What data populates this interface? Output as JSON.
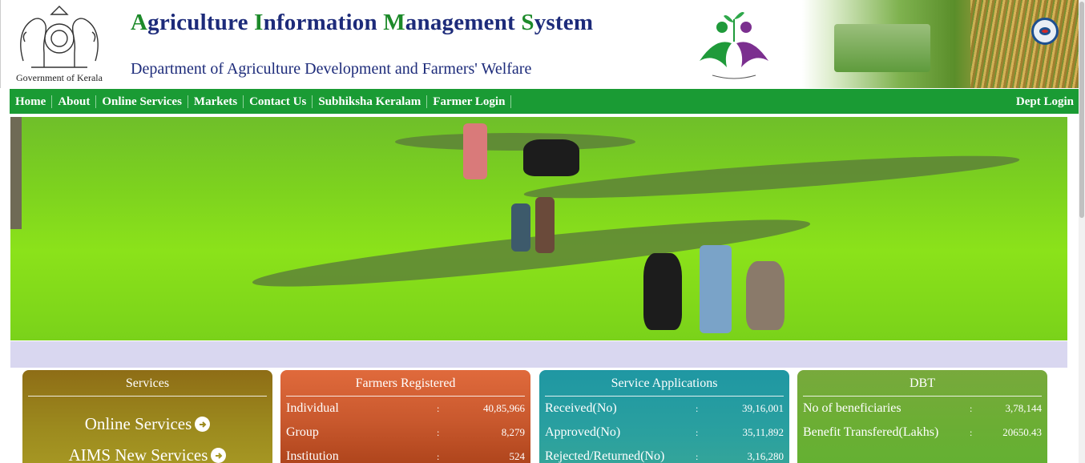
{
  "header": {
    "emblem_caption": "Government of Kerala",
    "title_parts": [
      {
        "text": "A",
        "green": true
      },
      {
        "text": "griculture ",
        "green": false
      },
      {
        "text": "I",
        "green": true
      },
      {
        "text": "nformation ",
        "green": false
      },
      {
        "text": "M",
        "green": true
      },
      {
        "text": "anagement ",
        "green": false
      },
      {
        "text": "S",
        "green": true
      },
      {
        "text": "ystem",
        "green": false
      }
    ],
    "subtitle": "Department of Agriculture Development and Farmers' Welfare"
  },
  "nav": {
    "items": [
      "Home",
      "About",
      "Online Services",
      "Markets",
      "Contact Us",
      "Subhiksha Keralam",
      "Farmer Login"
    ],
    "dept_login": "Dept Login"
  },
  "cards": {
    "services": {
      "title": "Services",
      "links": [
        "Online Services",
        "AIMS New Services"
      ]
    },
    "farmers": {
      "title": "Farmers Registered",
      "rows": [
        {
          "label": "Individual",
          "sep": ":",
          "value": "40,85,966"
        },
        {
          "label": "Group",
          "sep": ":",
          "value": "8,279"
        },
        {
          "label": "Institution",
          "sep": ":",
          "value": "524"
        }
      ]
    },
    "applications": {
      "title": "Service Applications",
      "rows": [
        {
          "label": "Received(No)",
          "sep": ":",
          "value": "39,16,001"
        },
        {
          "label": "Approved(No)",
          "sep": ":",
          "value": "35,11,892"
        },
        {
          "label": "Rejected/Returned(No)",
          "sep": ":",
          "value": "3,16,280"
        }
      ]
    },
    "dbt": {
      "title": "DBT",
      "rows": [
        {
          "label": "No of beneficiaries",
          "sep": ":",
          "value": "3,78,144"
        },
        {
          "label": "Benefit Transfered(Lakhs)",
          "sep": ":",
          "value": "20650.43"
        }
      ]
    }
  },
  "colors": {
    "nav_green": "#1a9b34",
    "title_blue": "#1d2b7a",
    "title_green": "#1d8a2a",
    "lilac": "#d9d7f0"
  },
  "icons": {
    "emblem": "kerala-emblem-icon",
    "logo": "farmers-welfare-logo-icon",
    "eye": "eye-badge-icon",
    "arrow": "arrow-circle-right-icon"
  }
}
